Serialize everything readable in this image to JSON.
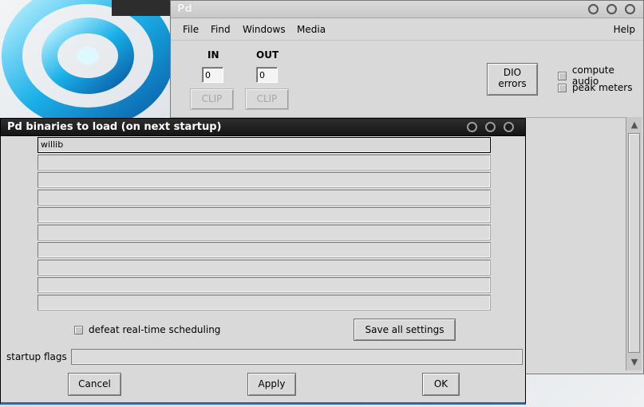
{
  "main_window": {
    "title": "Pd",
    "menu": {
      "file": "File",
      "find": "Find",
      "windows": "Windows",
      "media": "Media",
      "help": "Help"
    },
    "in_label": "IN",
    "out_label": "OUT",
    "in_value": "0",
    "out_value": "0",
    "clip_in_label": "CLIP",
    "clip_out_label": "CLIP",
    "dio_line1": "DIO",
    "dio_line2": "errors",
    "compute_audio_label": "compute audio",
    "peak_meters_label": "peak meters"
  },
  "dialog": {
    "title": "Pd binaries to load (on next startup)",
    "paths": [
      "willib",
      "",
      "",
      "",
      "",
      "",
      "",
      "",
      "",
      ""
    ],
    "defeat_rt_label": "defeat real-time scheduling",
    "save_all_label": "Save all settings",
    "startup_flags_label": "startup flags",
    "startup_flags_value": "",
    "cancel_label": "Cancel",
    "apply_label": "Apply",
    "ok_label": "OK"
  }
}
